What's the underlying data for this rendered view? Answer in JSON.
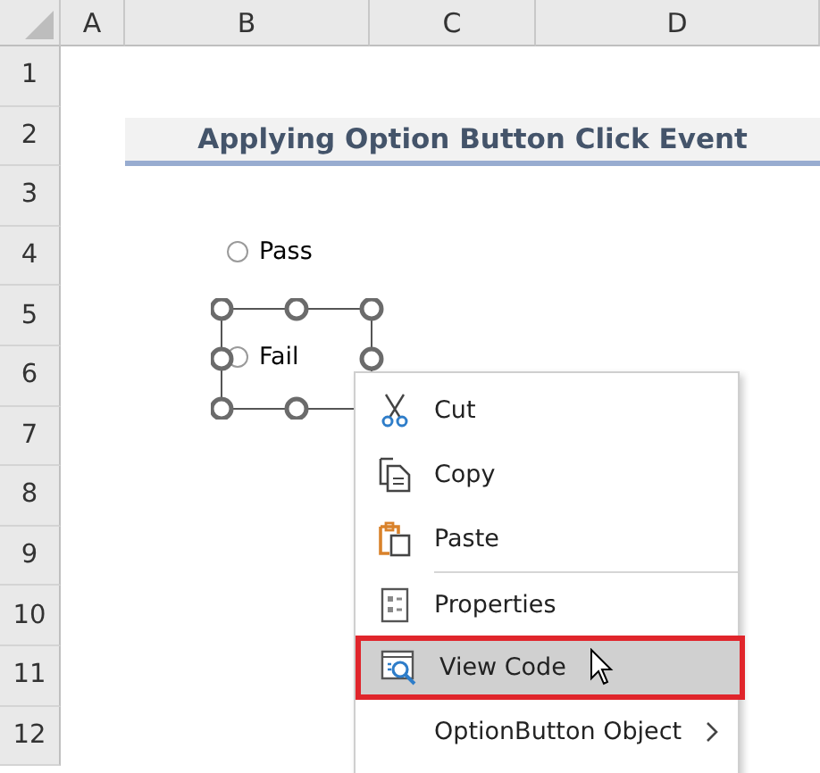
{
  "columns": [
    "A",
    "B",
    "C",
    "D"
  ],
  "rows": [
    "1",
    "2",
    "3",
    "4",
    "5",
    "6",
    "7",
    "8",
    "9",
    "10",
    "11",
    "12"
  ],
  "title": "Applying Option Button Click Event",
  "option_buttons": [
    {
      "label": "Pass",
      "selected": false,
      "object_selected": false
    },
    {
      "label": "Fail",
      "selected": false,
      "object_selected": true
    }
  ],
  "context_menu": {
    "items": [
      {
        "label": "Cut",
        "separator_before": false,
        "highlighted": false,
        "submenu": false
      },
      {
        "label": "Copy",
        "separator_before": false,
        "highlighted": false,
        "submenu": false
      },
      {
        "label": "Paste",
        "separator_before": false,
        "highlighted": false,
        "submenu": false
      },
      {
        "label": "Properties",
        "separator_before": true,
        "highlighted": false,
        "submenu": false
      },
      {
        "label": "View Code",
        "separator_before": false,
        "highlighted": true,
        "submenu": false
      },
      {
        "label": "OptionButton Object",
        "separator_before": false,
        "highlighted": false,
        "submenu": true
      }
    ]
  }
}
